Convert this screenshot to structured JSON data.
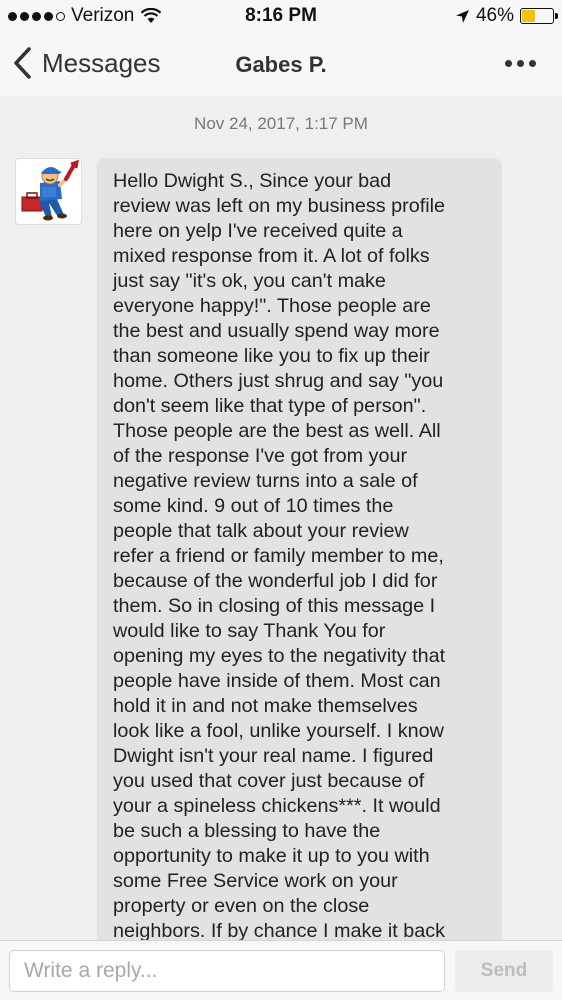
{
  "status_bar": {
    "carrier": "Verizon",
    "time": "8:16 PM",
    "battery_percent": "46%",
    "battery_level": 0.46,
    "signal_bars": 4,
    "icons": [
      "signal-dots-icon",
      "wifi-icon",
      "location-arrow-icon",
      "battery-icon"
    ]
  },
  "nav": {
    "back_label": "Messages",
    "title": "Gabes P.",
    "more_icon": "ellipsis-icon"
  },
  "thread": {
    "timestamp": "Nov 24, 2017, 1:17 PM",
    "avatar_icon": "plumber-mascot-avatar",
    "message": "Hello Dwight S.,  Since your bad\nreview was left on my business profile\nhere on yelp I've received quite a\nmixed response from it.  A lot of folks\njust say \"it's ok, you can't make\neveryone happy!\".  Those people are\nthe best and usually spend way more\nthan someone like you to fix up their\nhome. Others just shrug and say \"you\ndon't seem like that type of person\".\nThose people are the best as well.  All\nof the response I've got from your\nnegative review turns into a sale of\nsome kind.  9 out of 10 times the\npeople that talk about your review\nrefer a friend or family member to me,\nbecause of the wonderful job I did for\nthem.  So in closing of this message I\nwould like to say Thank You for\nopening my eyes to the negativity that\npeople have inside of them.  Most can\nhold it in and not make themselves\nlook like a fool, unlike yourself.  I know\nDwight isn't your real name.  I figured\nyou used that cover just because of\nyour a spineless chickens***.  It would\nbe such a blessing to have the\nopportunity to make it up to you with\nsome Free Service work on your\nproperty or even on the close\nneighbors.  If by chance I make it back"
  },
  "composer": {
    "placeholder": "Write a reply...",
    "value": "",
    "send_label": "Send"
  },
  "colors": {
    "bubble": "#e2e2e2",
    "background": "#efefef",
    "battery": "#f3c300",
    "send_disabled_text": "#bdbdbd"
  }
}
